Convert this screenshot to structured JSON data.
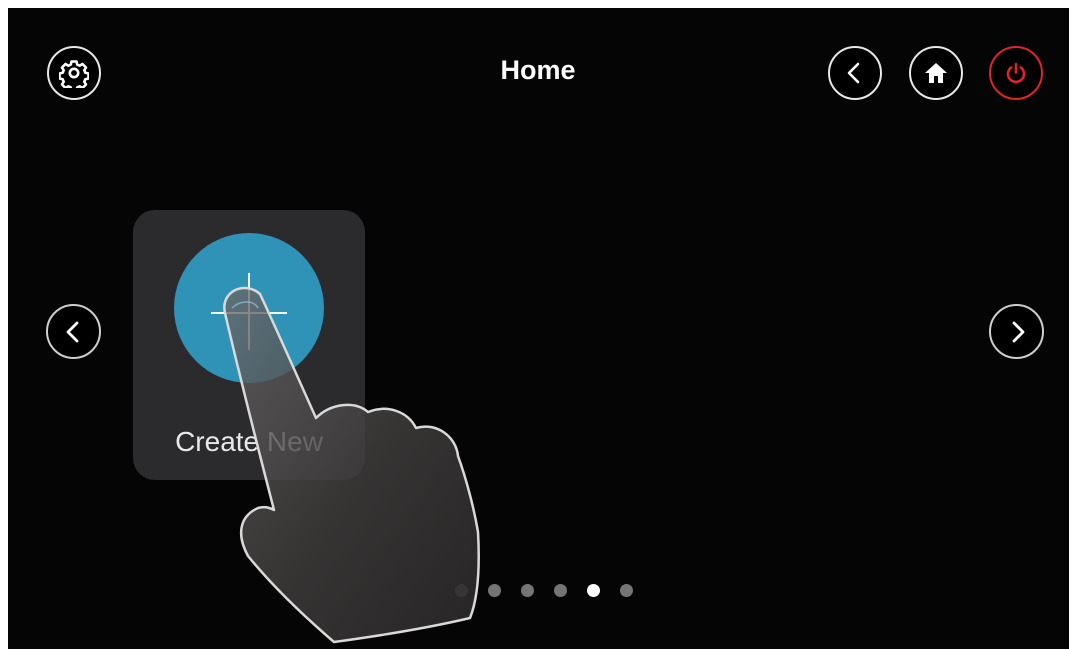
{
  "header": {
    "title": "Home",
    "settings_icon": "gear-icon",
    "back_icon": "chevron-left-icon",
    "home_icon": "home-icon",
    "power_icon": "power-icon",
    "power_color": "#e0242b"
  },
  "content": {
    "tiles": [
      {
        "label": "Create New",
        "icon": "plus-icon",
        "icon_color": "#2f93b8"
      }
    ]
  },
  "pagination": {
    "count": 6,
    "current": 5
  },
  "overlay": {
    "icon": "pointing-hand-icon"
  },
  "colors": {
    "background": "#050505",
    "tile": "#2b2b2d",
    "dot_inactive": "#757575",
    "dot_active": "#ffffff"
  }
}
